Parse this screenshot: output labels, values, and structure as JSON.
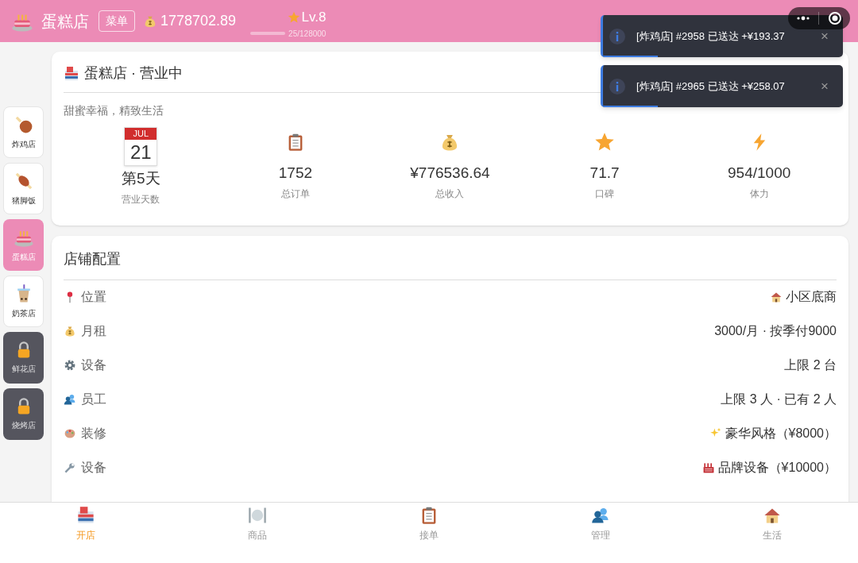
{
  "header": {
    "shop_name": "蛋糕店",
    "menu_button": "菜单",
    "money": "1778702.89",
    "level_label": "Lv.8",
    "exp": {
      "text": "25/128000"
    }
  },
  "toasts": [
    {
      "text": "[炸鸡店] #2958 已送达 +¥193.37",
      "close": "×",
      "level": 0.23
    },
    {
      "text": "[炸鸡店] #2965 已送达 +¥258.07",
      "close": "×",
      "level": 0.23
    }
  ],
  "sidebar": {
    "items": [
      {
        "label": "炸鸡店",
        "kind": "shop",
        "selected": false
      },
      {
        "label": "猪脚饭",
        "kind": "shop",
        "selected": false
      },
      {
        "label": "蛋糕店",
        "kind": "shop",
        "selected": true
      },
      {
        "label": "奶茶店",
        "kind": "shop",
        "selected": false
      },
      {
        "label": "鲜花店",
        "kind": "locked",
        "selected": false
      },
      {
        "label": "烧烤店",
        "kind": "locked",
        "selected": false
      }
    ]
  },
  "status_card": {
    "title": "蛋糕店 · 营业中",
    "slogan": "甜蜜幸福，精致生活",
    "stats": [
      {
        "kind": "calendar",
        "month": "JUL",
        "day": "21",
        "value": "第5天",
        "label": "营业天数"
      },
      {
        "kind": "orders",
        "value": "1752",
        "label": "总订单"
      },
      {
        "kind": "income",
        "value": "¥776536.64",
        "label": "总收入"
      },
      {
        "kind": "rating",
        "value": "71.7",
        "label": "口碑"
      },
      {
        "kind": "energy",
        "value": "954/1000",
        "label": "体力"
      }
    ]
  },
  "config_card": {
    "title": "店铺配置",
    "rows": [
      {
        "label": "位置",
        "value": "小区底商"
      },
      {
        "label": "月租",
        "value": "3000/月 · 按季付9000"
      },
      {
        "label": "设备",
        "value": "上限 2 台"
      },
      {
        "label": "员工",
        "value": "上限 3 人 · 已有 2 人"
      },
      {
        "label": "装修",
        "value": "豪华风格（¥8000）"
      },
      {
        "label": "设备",
        "value": "品牌设备（¥10000）"
      }
    ]
  },
  "tab_bar": [
    {
      "label": "开店",
      "selected": true
    },
    {
      "label": "商品",
      "selected": false
    },
    {
      "label": "接单",
      "selected": false
    },
    {
      "label": "管理",
      "selected": false
    },
    {
      "label": "生活",
      "selected": false
    }
  ]
}
